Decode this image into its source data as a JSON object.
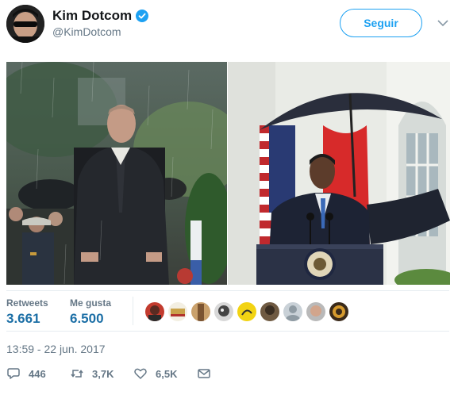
{
  "user": {
    "display_name": "Kim Dotcom",
    "handle": "@KimDotcom",
    "verified": true
  },
  "header": {
    "follow_label": "Seguir"
  },
  "stats": {
    "retweets_label": "Retweets",
    "retweets_value": "3.661",
    "likes_label": "Me gusta",
    "likes_value": "6.500"
  },
  "liker_avatars": [
    "avatar-1",
    "avatar-2",
    "avatar-3",
    "avatar-4",
    "avatar-5",
    "avatar-6",
    "avatar-7",
    "avatar-8",
    "avatar-9"
  ],
  "timestamp": "13:59 - 22 jun. 2017",
  "actions": {
    "reply_count": "446",
    "retweet_count": "3,7K",
    "like_count": "6,5K"
  },
  "colors": {
    "accent": "#1da1f2",
    "stat_value": "#1c6fa6",
    "muted": "#657786"
  }
}
